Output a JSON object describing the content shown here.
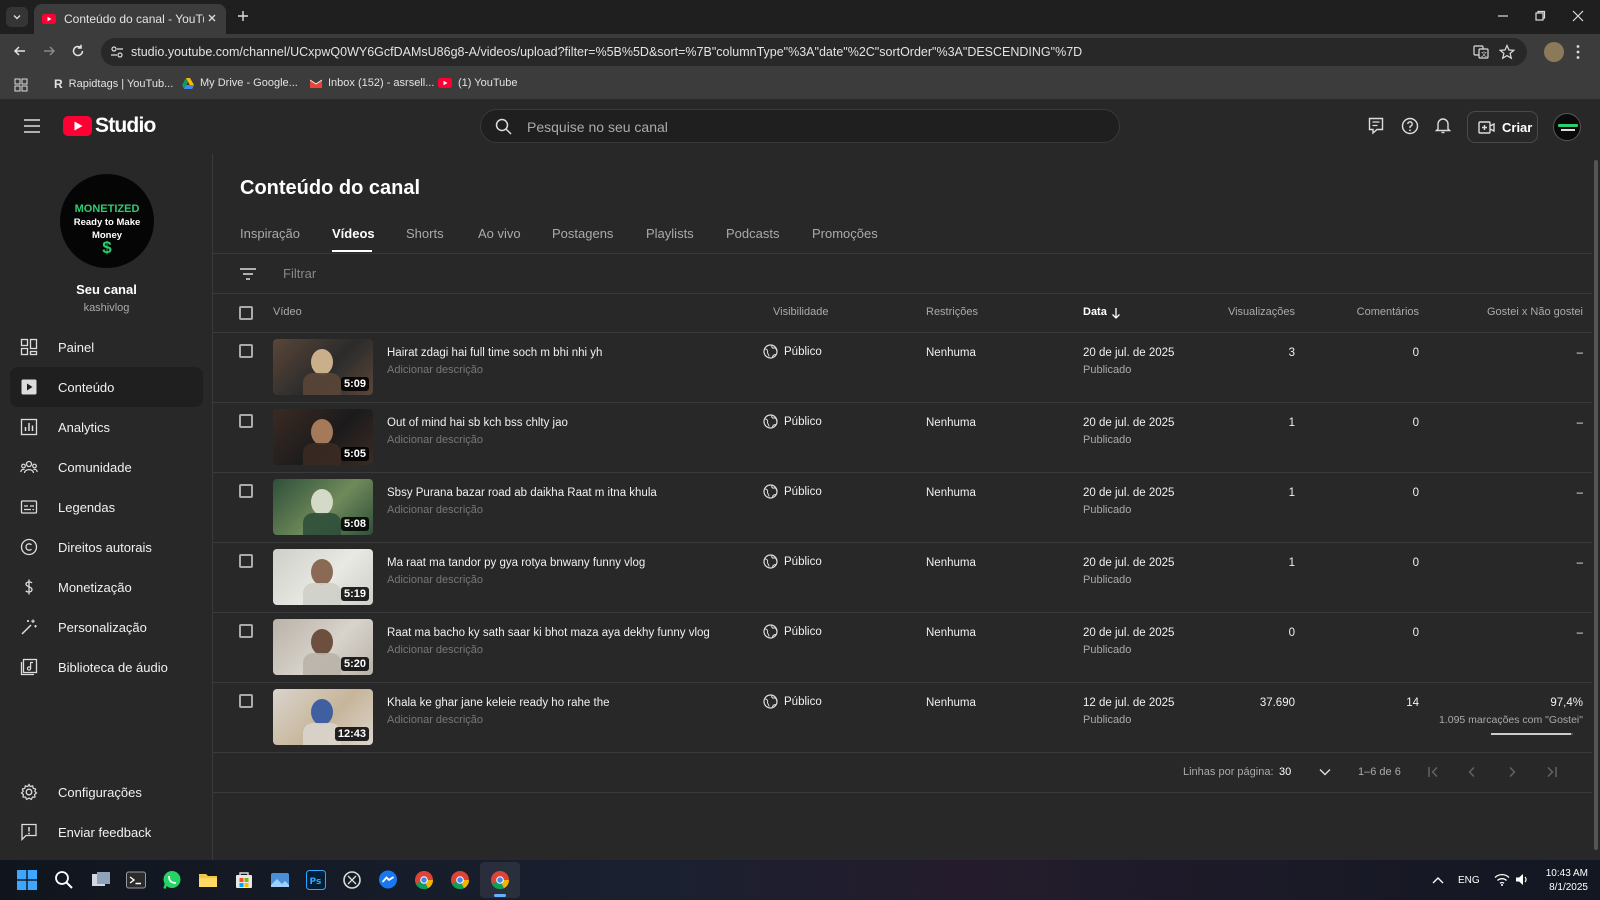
{
  "browser": {
    "tab_title": "Conteúdo do canal - YouTube Studio",
    "url": "studio.youtube.com/channel/UCxpwQ0WY6GcfDAMsU86g8-A/videos/upload?filter=%5B%5D&sort=%7B\"columnType\"%3A\"date\"%2C\"sortOrder\"%3A\"DESCENDING\"%7D",
    "bookmarks": [
      {
        "label": "Rapidtags | YouTub..."
      },
      {
        "label": "My Drive - Google..."
      },
      {
        "label": "Inbox (152) - asrsell..."
      },
      {
        "label": "(1) YouTube"
      }
    ]
  },
  "header": {
    "logo_text": "Studio",
    "search_placeholder": "Pesquise no seu canal",
    "create_label": "Criar"
  },
  "channel": {
    "badge_line1": "MONETIZED",
    "badge_line2": "Ready to Make",
    "badge_line3": "Money",
    "badge_symbol": "$",
    "name": "Seu canal",
    "handle": "kashivlog"
  },
  "sidebar": {
    "items": [
      {
        "label": "Painel"
      },
      {
        "label": "Conteúdo"
      },
      {
        "label": "Analytics"
      },
      {
        "label": "Comunidade"
      },
      {
        "label": "Legendas"
      },
      {
        "label": "Direitos autorais"
      },
      {
        "label": "Monetização"
      },
      {
        "label": "Personalização"
      },
      {
        "label": "Biblioteca de áudio"
      }
    ],
    "bottom": [
      {
        "label": "Configurações"
      },
      {
        "label": "Enviar feedback"
      }
    ]
  },
  "main": {
    "title": "Conteúdo do canal",
    "tabs": [
      {
        "label": "Inspiração"
      },
      {
        "label": "Vídeos"
      },
      {
        "label": "Shorts"
      },
      {
        "label": "Ao vivo"
      },
      {
        "label": "Postagens"
      },
      {
        "label": "Playlists"
      },
      {
        "label": "Podcasts"
      },
      {
        "label": "Promoções"
      }
    ],
    "filter_placeholder": "Filtrar",
    "columns": {
      "video": "Vídeo",
      "visibility": "Visibilidade",
      "restrictions": "Restrições",
      "date": "Data",
      "views": "Visualizações",
      "comments": "Comentários",
      "likes": "Gostei x Não gostei"
    },
    "rows": [
      {
        "title": "Hairat zdagi hai full time soch m bhi nhi yh",
        "description": "Adicionar descrição",
        "duration": "5:09",
        "visibility": "Público",
        "restrictions": "Nenhuma",
        "date": "20 de jul. de 2025",
        "status": "Publicado",
        "views": "3",
        "comments": "0",
        "likes": "–",
        "likes_sub": ""
      },
      {
        "title": "Out of mind hai sb kch bss chlty jao",
        "description": "Adicionar descrição",
        "duration": "5:05",
        "visibility": "Público",
        "restrictions": "Nenhuma",
        "date": "20 de jul. de 2025",
        "status": "Publicado",
        "views": "1",
        "comments": "0",
        "likes": "–",
        "likes_sub": ""
      },
      {
        "title": "Sbsy Purana bazar road ab daikha Raat m itna khula",
        "description": "Adicionar descrição",
        "duration": "5:08",
        "visibility": "Público",
        "restrictions": "Nenhuma",
        "date": "20 de jul. de 2025",
        "status": "Publicado",
        "views": "1",
        "comments": "0",
        "likes": "–",
        "likes_sub": ""
      },
      {
        "title": "Ma raat ma tandor py gya rotya bnwany funny vlog",
        "description": "Adicionar descrição",
        "duration": "5:19",
        "visibility": "Público",
        "restrictions": "Nenhuma",
        "date": "20 de jul. de 2025",
        "status": "Publicado",
        "views": "1",
        "comments": "0",
        "likes": "–",
        "likes_sub": ""
      },
      {
        "title": "Raat ma bacho ky sath saar ki bhot maza aya dekhy funny vlog",
        "description": "Adicionar descrição",
        "duration": "5:20",
        "visibility": "Público",
        "restrictions": "Nenhuma",
        "date": "20 de jul. de 2025",
        "status": "Publicado",
        "views": "0",
        "comments": "0",
        "likes": "–",
        "likes_sub": ""
      },
      {
        "title": "Khala ke ghar jane keleie ready ho rahe the",
        "description": "Adicionar descrição",
        "duration": "12:43",
        "visibility": "Público",
        "restrictions": "Nenhuma",
        "date": "12 de jul. de 2025",
        "status": "Publicado",
        "views": "37.690",
        "comments": "14",
        "likes": "97,4%",
        "likes_sub": "1.095 marcações com \"Gostei\"",
        "like_ratio": 0.974
      }
    ],
    "pagination": {
      "rows_label": "Linhas por página:",
      "rows_value": "30",
      "range": "1–6 de 6"
    }
  },
  "taskbar": {
    "lang": "ENG",
    "time": "10:43 AM",
    "date": "8/1/2025"
  }
}
